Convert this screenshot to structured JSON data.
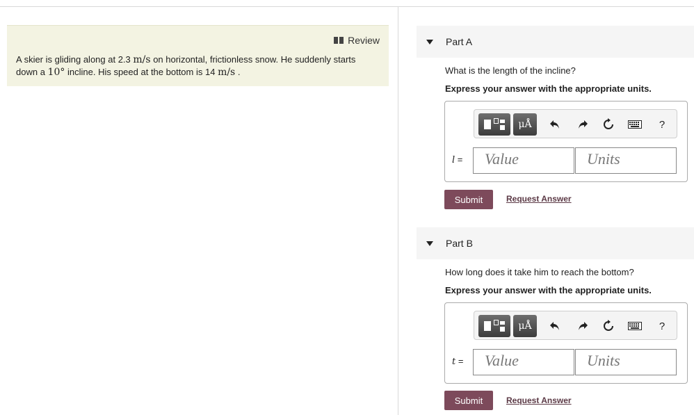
{
  "problem": {
    "review_label": "Review",
    "text_1": "A skier is gliding along at 2.3 ",
    "unit_1": "m/s",
    "text_2": " on horizontal, frictionless snow. He suddenly starts down a ",
    "angle": "10°",
    "text_3": " incline. His speed at the bottom is 14 ",
    "unit_2": "m/s",
    "text_4": " ."
  },
  "parts": [
    {
      "title": "Part A",
      "question": "What is the length of the incline?",
      "instruction": "Express your answer with the appropriate units.",
      "variable": "l",
      "equals": " =",
      "units_button": "μÅ",
      "help": "?",
      "value_placeholder": "Value",
      "units_placeholder": "Units",
      "submit_label": "Submit",
      "request_label": "Request Answer"
    },
    {
      "title": "Part B",
      "question": "How long does it take him to reach the bottom?",
      "instruction": "Express your answer with the appropriate units.",
      "variable": "t",
      "equals": " =",
      "units_button": "μÅ",
      "help": "?",
      "value_placeholder": "Value",
      "units_placeholder": "Units",
      "submit_label": "Submit",
      "request_label": "Request Answer"
    }
  ],
  "icons": {
    "review": "book-icon",
    "collapse": "caret-down-icon",
    "template": "templates-icon",
    "undo": "undo-icon",
    "redo": "redo-icon",
    "reset": "reset-icon",
    "keyboard": "keyboard-icon"
  },
  "colors": {
    "problem_bg": "#f3f3e2",
    "submit_bg": "#7d4a5b",
    "link": "#5c3a46"
  }
}
